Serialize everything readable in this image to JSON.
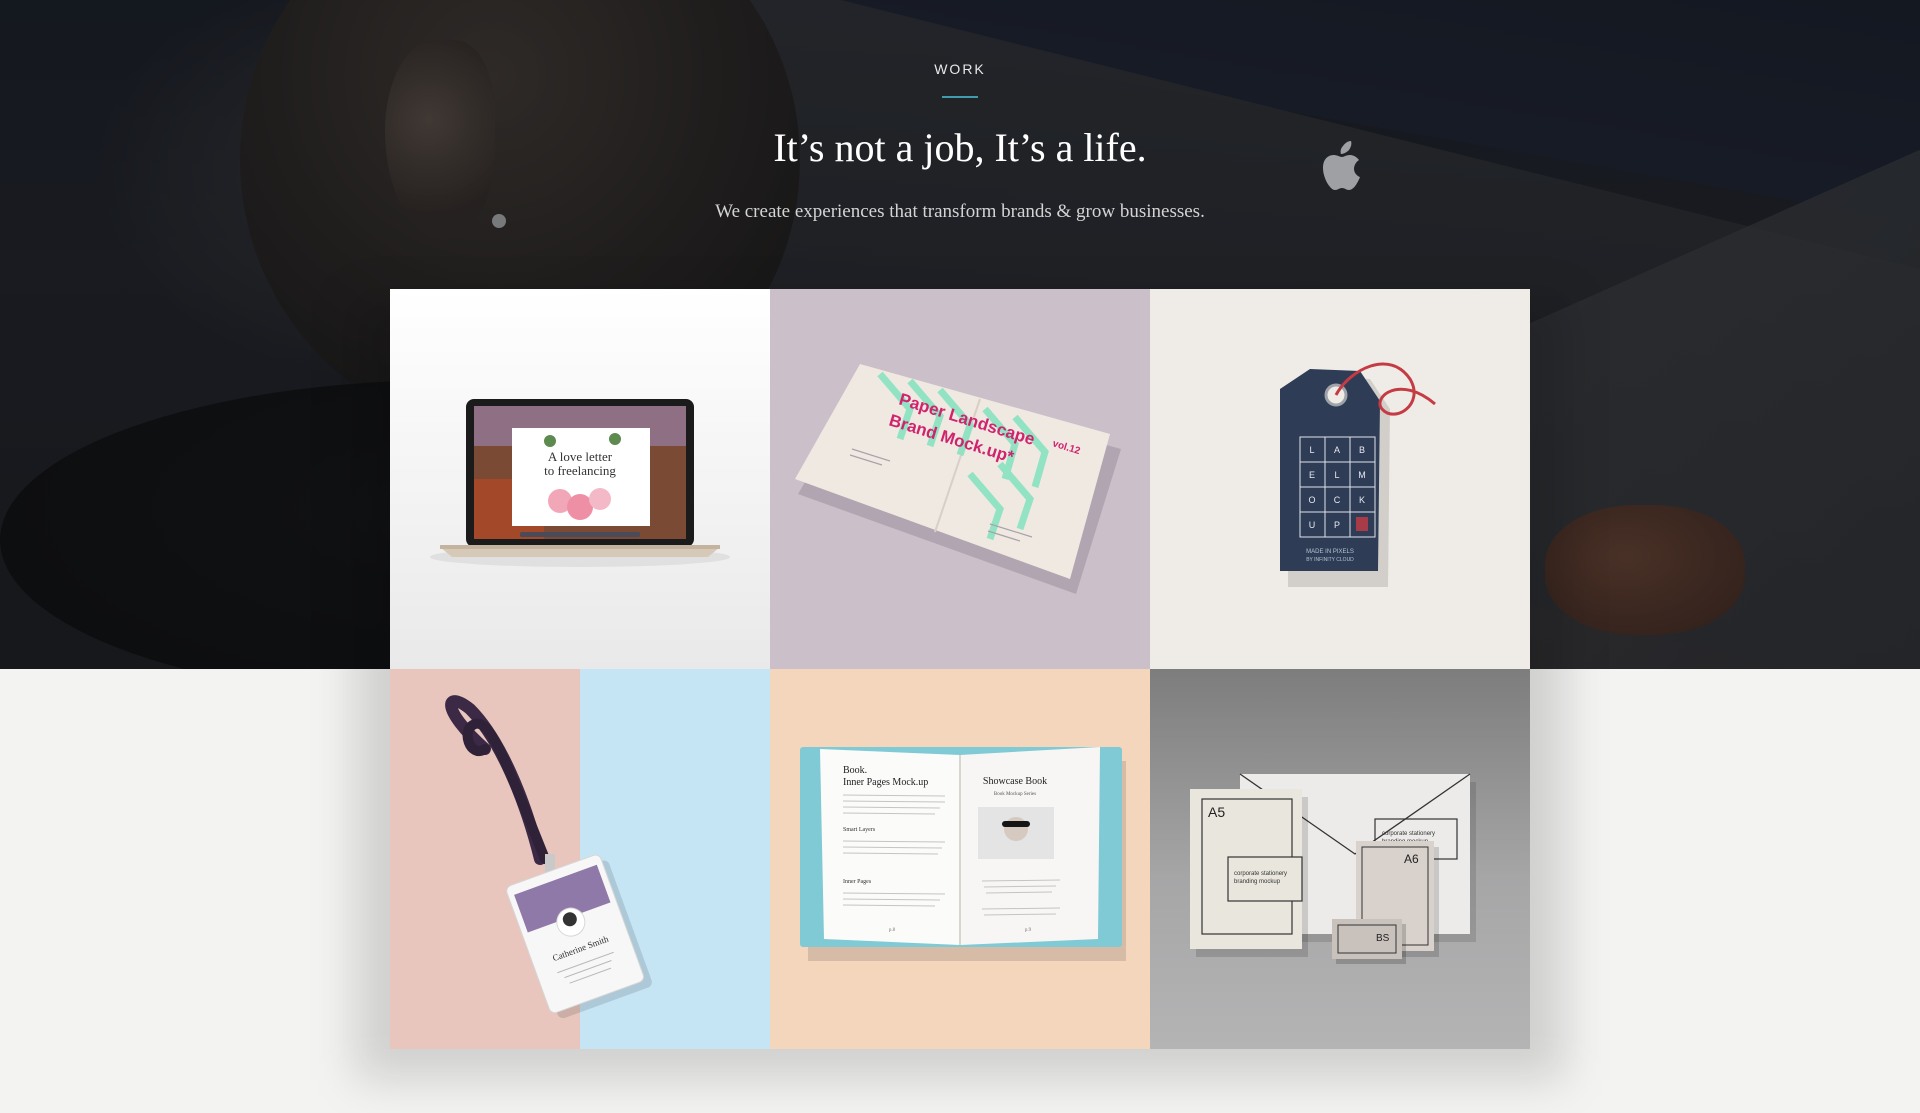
{
  "section": {
    "label": "WORK",
    "headline": "It’s not a job, It’s a life.",
    "subline": "We create experiences that transform brands & grow businesses.",
    "accent_color": "#3f9bb0"
  },
  "portfolio": {
    "laptop": {
      "screen_title_1": "A love letter",
      "screen_title_2": "to freelancing"
    },
    "paper": {
      "title_1": "Paper Landscape",
      "title_2": "Brand Mock.up*",
      "volume": "vol.12"
    },
    "tag": {
      "grid_letters": [
        "L",
        "A",
        "B",
        "E",
        "L",
        "M",
        "O",
        "C",
        "K",
        "U",
        "P"
      ],
      "footer_1": "MADE IN PIXELS",
      "footer_2": "BY INFINITY CLOUD"
    },
    "badge": {
      "name": "Catherine Smith"
    },
    "book": {
      "left_title_1": "Book.",
      "left_title_2": "Inner Pages Mock.up",
      "left_sub_1": "Smart Layers",
      "left_sub_2": "Inner Pages",
      "right_title": "Showcase Book",
      "right_sub": "Book Mockup Series",
      "page_left": "p.8",
      "page_right": "p.9"
    },
    "stationery": {
      "a5_label": "A5",
      "a6_label": "A6",
      "bs_label": "BS",
      "mockup_label_1": "corporate stationery",
      "mockup_label_2": "branding mockup"
    }
  }
}
